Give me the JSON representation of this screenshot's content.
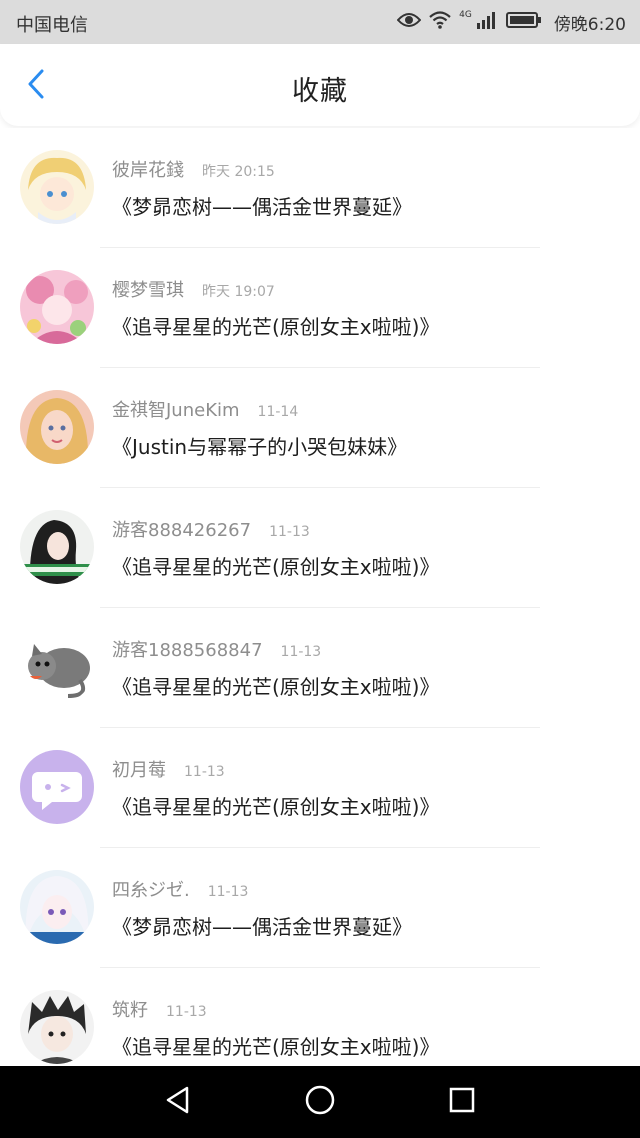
{
  "status_bar": {
    "carrier": "中国电信",
    "network": "4G",
    "time": "傍晚6:20",
    "icons": [
      "eye-icon",
      "wifi-icon",
      "signal-icon",
      "battery-icon"
    ]
  },
  "header": {
    "title": "收藏",
    "back_icon": "chevron-left-icon",
    "accent_color": "#2a8cf0"
  },
  "favorites": [
    {
      "user": "彼岸花錢",
      "time": "昨天 20:15",
      "title": "《梦昴恋树——偶活金世界蔓延》"
    },
    {
      "user": "樱梦雪琪",
      "time": "昨天 19:07",
      "title": "《追寻星星的光芒(原创女主x啦啦)》"
    },
    {
      "user": "金祺智JuneKim",
      "time": "11-14",
      "title": "《Justin与幂幂子的小哭包妹妹》"
    },
    {
      "user": "游客888426267",
      "time": "11-13",
      "title": "《追寻星星的光芒(原创女主x啦啦)》"
    },
    {
      "user": "游客1888568847",
      "time": "11-13",
      "title": "《追寻星星的光芒(原创女主x啦啦)》"
    },
    {
      "user": "初月莓",
      "time": "11-13",
      "title": "《追寻星星的光芒(原创女主x啦啦)》"
    },
    {
      "user": "四糸ジゼ.",
      "time": "11-13",
      "title": "《梦昴恋树——偶活金世界蔓延》"
    },
    {
      "user": "筑籽",
      "time": "11-13",
      "title": "《追寻星星的光芒(原创女主x啦啦)》"
    }
  ],
  "nav_bar": {
    "icons": [
      "back-triangle-icon",
      "home-circle-icon",
      "recents-square-icon"
    ]
  }
}
